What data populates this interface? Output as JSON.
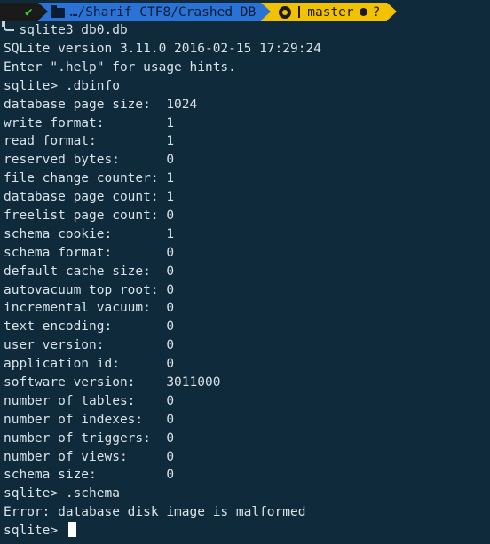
{
  "prompt": {
    "status_symbol": "✔",
    "path": "…/Sharif CTF8/Crashed DB",
    "branch": "master",
    "git_state": "?",
    "colors": {
      "status_bg": "#1a1a1a",
      "status_fg": "#37d02d",
      "dir_bg": "#2b72d6",
      "git_bg": "#f2c200"
    },
    "icons": [
      "check-icon",
      "folder-icon",
      "github-icon",
      "branch-icon",
      "dirty-dot-icon"
    ]
  },
  "terminal": {
    "first_command": "sqlite3 db0.db",
    "lines": [
      "SQLite version 3.11.0 2016-02-15 17:29:24",
      "Enter \".help\" for usage hints.",
      "sqlite> .dbinfo",
      "database page size:  1024",
      "write format:        1",
      "read format:         1",
      "reserved bytes:      0",
      "file change counter: 1",
      "database page count: 1",
      "freelist page count: 0",
      "schema cookie:       1",
      "schema format:       0",
      "default cache size:  0",
      "autovacuum top root: 0",
      "incremental vacuum:  0",
      "text encoding:       0",
      "user version:        0",
      "application id:      0",
      "software version:    3011000",
      "number of tables:    0",
      "number of indexes:   0",
      "number of triggers:  0",
      "number of views:     0",
      "schema size:         0",
      "sqlite> .schema",
      "Error: database disk image is malformed"
    ],
    "current_prompt": "sqlite> "
  }
}
